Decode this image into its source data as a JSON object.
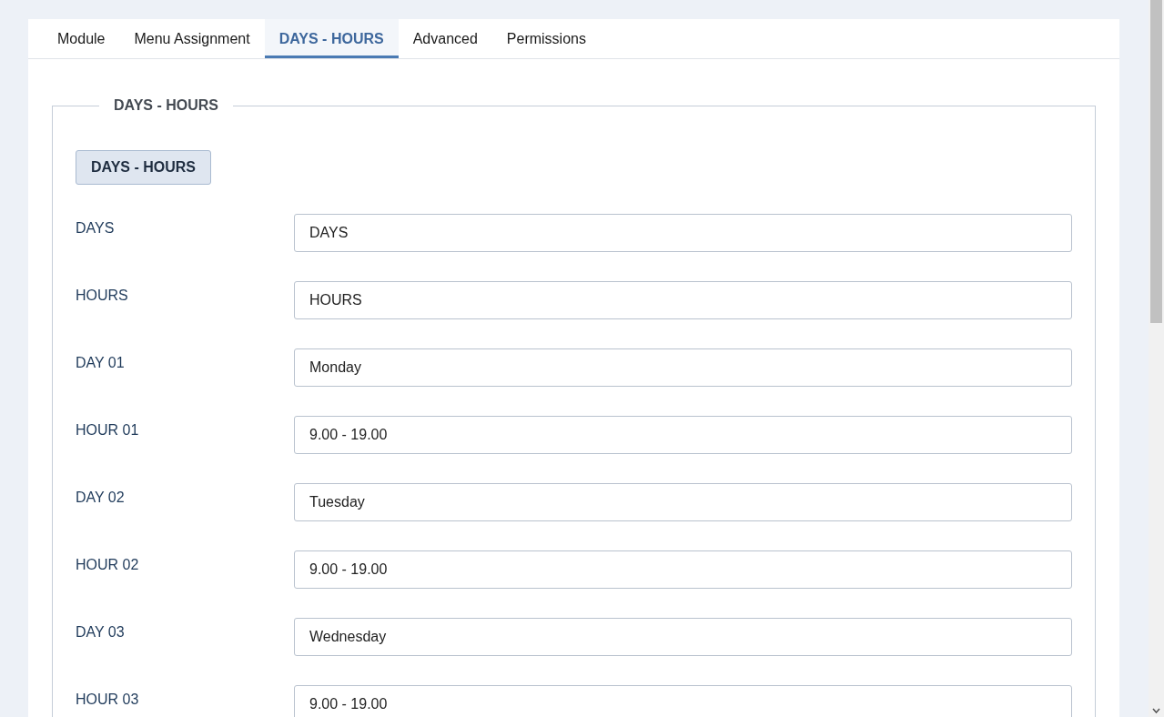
{
  "tabs": [
    {
      "label": "Module",
      "selected": false
    },
    {
      "label": "Menu Assignment",
      "selected": false
    },
    {
      "label": "DAYS - HOURS",
      "selected": true
    },
    {
      "label": "Advanced",
      "selected": false
    },
    {
      "label": "Permissions",
      "selected": false
    }
  ],
  "fieldset": {
    "legend": "DAYS - HOURS",
    "button": "DAYS - HOURS",
    "fields": [
      {
        "label": "DAYS",
        "value": "DAYS"
      },
      {
        "label": "HOURS",
        "value": "HOURS"
      },
      {
        "label": "DAY 01",
        "value": "Monday"
      },
      {
        "label": "HOUR 01",
        "value": "9.00 - 19.00"
      },
      {
        "label": "DAY 02",
        "value": "Tuesday"
      },
      {
        "label": "HOUR 02",
        "value": "9.00 - 19.00"
      },
      {
        "label": "DAY 03",
        "value": "Wednesday"
      },
      {
        "label": "HOUR 03",
        "value": "9.00 - 19.00"
      }
    ]
  }
}
